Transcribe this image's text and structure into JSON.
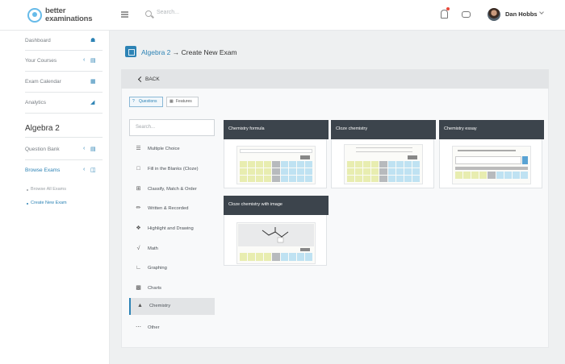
{
  "header": {
    "logo_line1": "better",
    "logo_line2": "examinations",
    "search_placeholder": "Search...",
    "user_name": "Dan Hobbs"
  },
  "sidebar": {
    "items": [
      {
        "label": "Dashboard",
        "icon": "home-icon"
      },
      {
        "label": "Your Courses",
        "icon": "courses-icon"
      },
      {
        "label": "Exam Calendar",
        "icon": "calendar-icon"
      },
      {
        "label": "Analytics",
        "icon": "chart-icon"
      }
    ],
    "section_title": "Algebra 2",
    "course_items": [
      {
        "label": "Question Bank",
        "icon": "question-bank-icon"
      },
      {
        "label": "Browse Exams",
        "icon": "exams-icon"
      }
    ],
    "sub_items": [
      {
        "label": "Browse All Exams"
      },
      {
        "label": "Create New Exam"
      }
    ]
  },
  "page": {
    "breadcrumb_link": "Algebra 2",
    "breadcrumb_arrow": "→",
    "breadcrumb_current": "Create New Exam",
    "back_label": "BACK"
  },
  "toolbar": {
    "questions_label": "Questions",
    "features_label": "Features"
  },
  "filter": {
    "placeholder": "Search..."
  },
  "categories": [
    {
      "label": "Multiple Choice",
      "icon": "list-icon"
    },
    {
      "label": "Fill in the Blanks (Cloze)",
      "icon": "blank-box-icon"
    },
    {
      "label": "Classify, Match & Order",
      "icon": "grid-icon"
    },
    {
      "label": "Written & Recorded",
      "icon": "pencil-icon"
    },
    {
      "label": "Highlight and Drawing",
      "icon": "highlight-icon"
    },
    {
      "label": "Math",
      "icon": "math-icon"
    },
    {
      "label": "Graphing",
      "icon": "graph-icon"
    },
    {
      "label": "Charts",
      "icon": "bar-chart-icon"
    },
    {
      "label": "Chemistry",
      "icon": "flask-icon",
      "selected": true
    },
    {
      "label": "Other",
      "icon": "more-icon"
    }
  ],
  "cards": [
    {
      "title": "Chemistry formula"
    },
    {
      "title": "Cloze chemistry"
    },
    {
      "title": "Chemistry essay"
    },
    {
      "title": "Cloze chemistry with image"
    }
  ],
  "colors": {
    "accent": "#2d83b5",
    "card_header": "#3c444c",
    "keypad_yellow": "#e8edb0",
    "keypad_blue": "#bfe2f2"
  }
}
